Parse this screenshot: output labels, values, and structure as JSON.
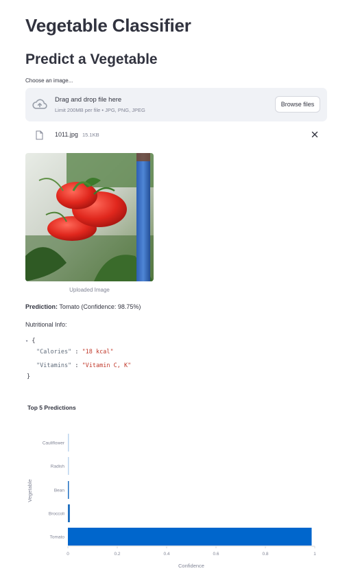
{
  "app": {
    "title": "Vegetable Classifier",
    "subtitle": "Predict a Vegetable"
  },
  "uploader": {
    "label": "Choose an image...",
    "drop_title": "Drag and drop file here",
    "drop_sub": "Limit 200MB per file • JPG, PNG, JPEG",
    "browse_label": "Browse files",
    "file_name": "1011.jpg",
    "file_size": "15.1KB"
  },
  "image": {
    "caption": "Uploaded Image"
  },
  "result": {
    "prediction_label": "Prediction:",
    "prediction_value": "Tomato (Confidence: 98.75%)",
    "nutrition_label": "Nutritional Info:"
  },
  "nutrition": {
    "open_brace": "{",
    "close_brace": "}",
    "items": [
      {
        "key": "\"Calories\"",
        "value": "\"18 kcal\""
      },
      {
        "key": "\"Vitamins\"",
        "value": "\"Vitamin C, K\""
      }
    ]
  },
  "chart_data": {
    "type": "bar",
    "orientation": "horizontal",
    "title": "Top 5 Predictions",
    "xlabel": "Confidence",
    "ylabel": "Vegetable",
    "categories": [
      "Cauliflower",
      "Radish",
      "Bean",
      "Broccoli",
      "Tomato"
    ],
    "values": [
      0.001,
      0.001,
      0.004,
      0.008,
      0.9875
    ],
    "xlim": [
      0,
      1
    ],
    "xticks": [
      "0",
      "0.2",
      "0.4",
      "0.6",
      "0.8",
      "1"
    ],
    "colors": [
      "#bcd4ee",
      "#bcd4ee",
      "#1f6fc0",
      "#1f6fc0",
      "#0066cc"
    ],
    "grid": false,
    "legend": "none"
  }
}
